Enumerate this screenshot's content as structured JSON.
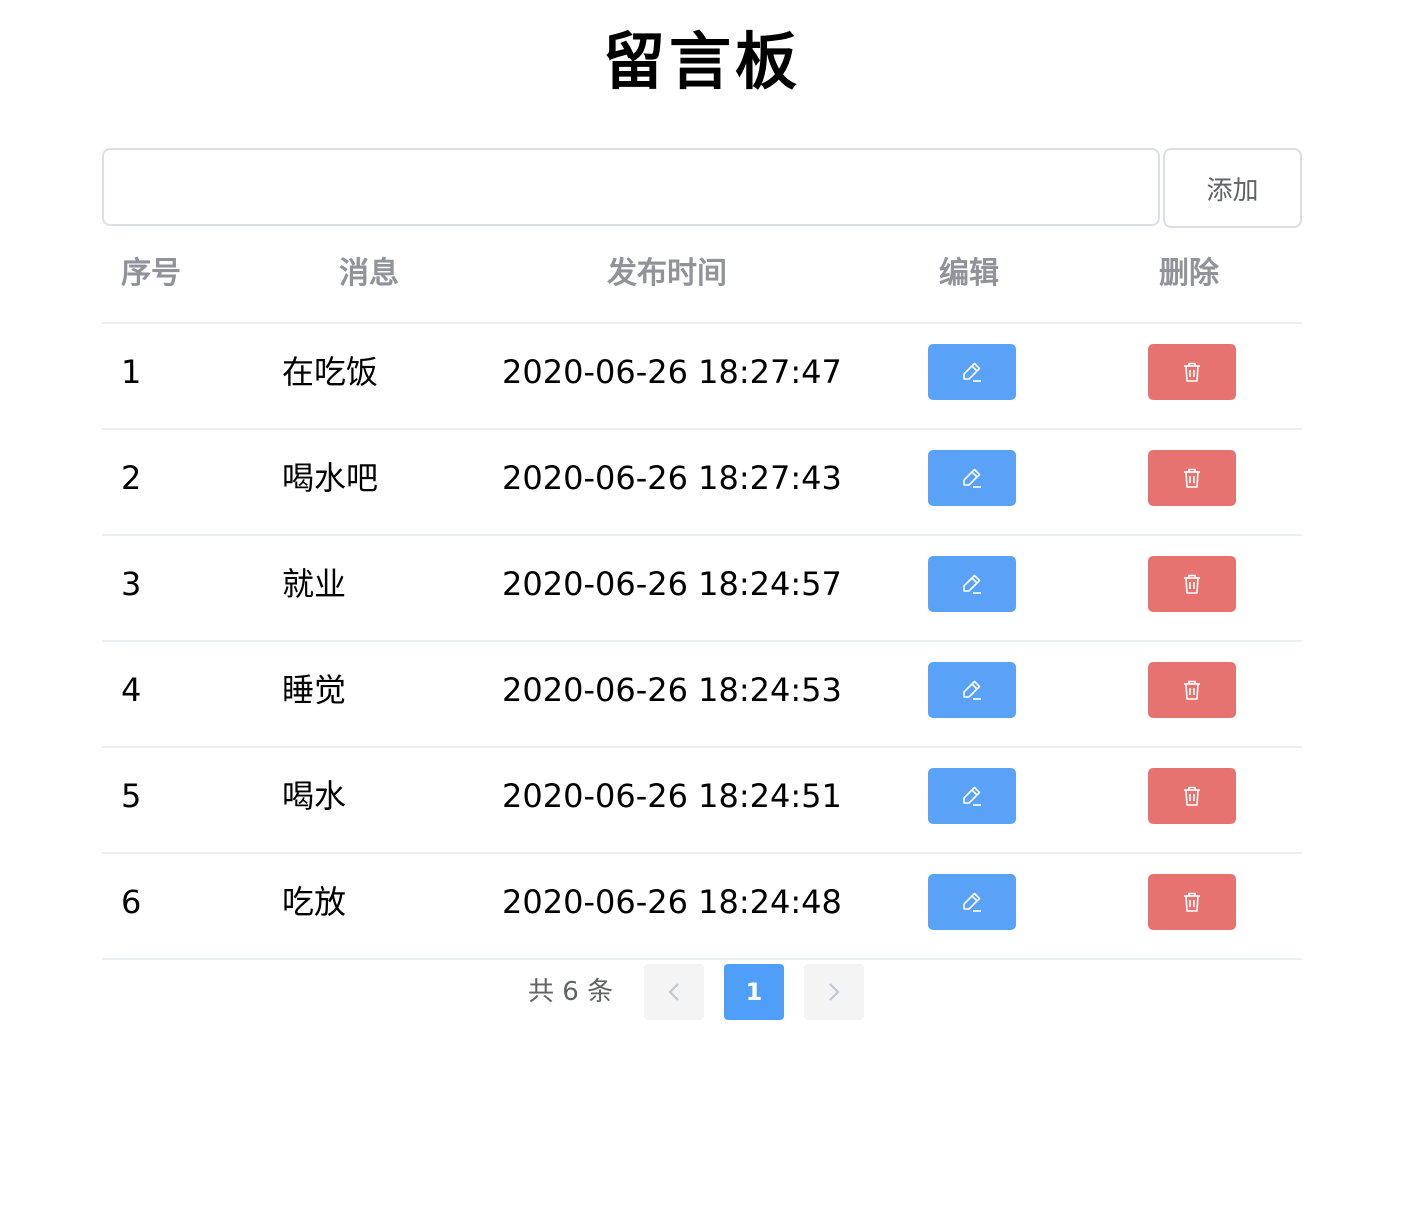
{
  "title": "留言板",
  "add_form": {
    "input_value": "",
    "input_placeholder": "",
    "add_label": "添加"
  },
  "table": {
    "headers": {
      "index": "序号",
      "message": "消息",
      "time": "发布时间",
      "edit": "编辑",
      "delete": "删除"
    },
    "rows": [
      {
        "index": "1",
        "message": "在吃饭",
        "time": "2020-06-26 18:27:47"
      },
      {
        "index": "2",
        "message": "喝水吧",
        "time": "2020-06-26 18:27:43"
      },
      {
        "index": "3",
        "message": "就业",
        "time": "2020-06-26 18:24:57"
      },
      {
        "index": "4",
        "message": "睡觉",
        "time": "2020-06-26 18:24:53"
      },
      {
        "index": "5",
        "message": "喝水",
        "time": "2020-06-26 18:24:51"
      },
      {
        "index": "6",
        "message": "吃放",
        "time": "2020-06-26 18:24:48"
      }
    ],
    "edit_icon": "pencil-icon",
    "delete_icon": "trash-icon"
  },
  "pagination": {
    "total_text": "共 6 条",
    "current_page": "1",
    "prev_icon": "chevron-left-icon",
    "next_icon": "chevron-right-icon"
  },
  "colors": {
    "primary": "#5aa2f7",
    "danger": "#e6736f",
    "header_text": "#909399",
    "border": "#ebeef5"
  }
}
